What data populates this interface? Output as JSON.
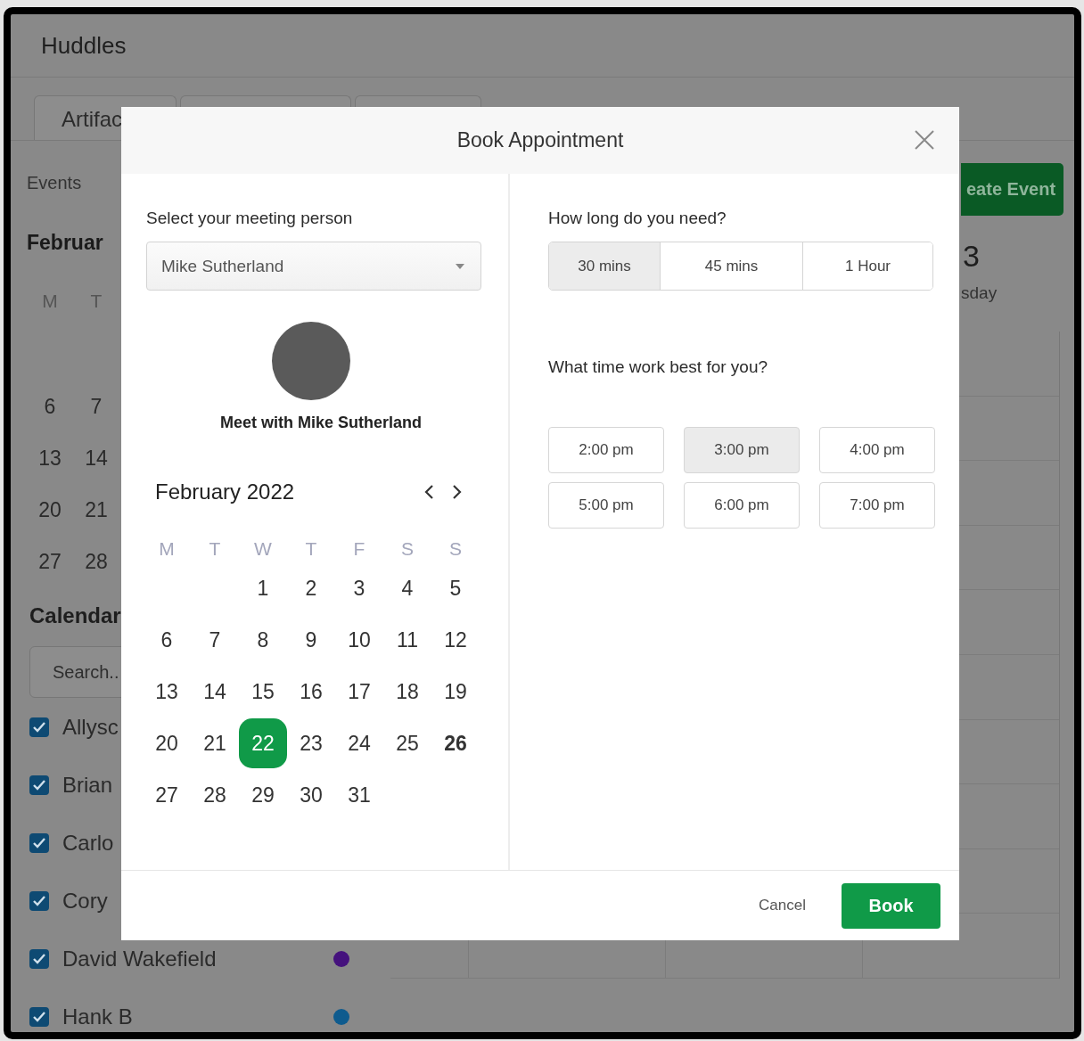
{
  "app": {
    "title": "Huddles",
    "tabs": [
      {
        "kind": "labelled",
        "label": "Artifac"
      },
      {
        "kind": "blank"
      },
      {
        "kind": "blank"
      }
    ],
    "sidebar": {
      "section": "Events",
      "month": "Februar",
      "mini_calendar": {
        "weekdays": [
          "M",
          "T"
        ],
        "rows": [
          [
            "6",
            "7"
          ],
          [
            "13",
            "14"
          ],
          [
            "20",
            "21"
          ],
          [
            "27",
            "28"
          ]
        ]
      },
      "calendars_title": "Calendar",
      "search": {
        "placeholder": "Search.."
      },
      "people": [
        {
          "name": "Allysc",
          "checked": true
        },
        {
          "name": "Brian",
          "checked": true
        },
        {
          "name": "Carlo",
          "checked": true
        },
        {
          "name": "Cory",
          "checked": true
        },
        {
          "name": "David Wakefield",
          "checked": true,
          "color": "#45127d"
        },
        {
          "name": "Hank B",
          "checked": true,
          "color": "#0e5b8e"
        }
      ]
    },
    "main": {
      "create_button": "eate Event",
      "day_number": "3",
      "day_name": "sday"
    }
  },
  "modal": {
    "title": "Book Appointment",
    "person": {
      "label": "Select your meeting person",
      "value": "Mike Sutherland",
      "meet_text": "Meet with Mike Sutherland"
    },
    "calendar": {
      "month": "February 2022",
      "weekdays": [
        "M",
        "T",
        "W",
        "T",
        "F",
        "S",
        "S"
      ],
      "weeks": [
        [
          {
            "d": "1",
            "selected": false,
            "today": false
          },
          {
            "d": "2",
            "selected": false,
            "today": false
          },
          {
            "d": "3",
            "selected": false,
            "today": false
          },
          {
            "d": "4",
            "selected": false,
            "today": false
          },
          {
            "d": "5",
            "selected": false,
            "today": false
          }
        ],
        [
          {
            "d": "6",
            "selected": false,
            "today": false
          },
          {
            "d": "7",
            "selected": false,
            "today": false
          },
          {
            "d": "8",
            "selected": false,
            "today": false
          },
          {
            "d": "9",
            "selected": false,
            "today": false
          },
          {
            "d": "10",
            "selected": false,
            "today": false
          },
          {
            "d": "11",
            "selected": false,
            "today": false
          },
          {
            "d": "12",
            "selected": false,
            "today": false
          }
        ],
        [
          {
            "d": "13",
            "selected": false,
            "today": false
          },
          {
            "d": "14",
            "selected": false,
            "today": false
          },
          {
            "d": "15",
            "selected": false,
            "today": false
          },
          {
            "d": "16",
            "selected": false,
            "today": false
          },
          {
            "d": "17",
            "selected": false,
            "today": false
          },
          {
            "d": "18",
            "selected": false,
            "today": false
          },
          {
            "d": "19",
            "selected": false,
            "today": false
          }
        ],
        [
          {
            "d": "20",
            "selected": false,
            "today": false
          },
          {
            "d": "21",
            "selected": false,
            "today": false
          },
          {
            "d": "22",
            "selected": true,
            "today": false
          },
          {
            "d": "23",
            "selected": false,
            "today": false
          },
          {
            "d": "24",
            "selected": false,
            "today": false
          },
          {
            "d": "25",
            "selected": false,
            "today": false
          },
          {
            "d": "26",
            "selected": false,
            "today": true
          }
        ],
        [
          {
            "d": "27",
            "selected": false,
            "today": false
          },
          {
            "d": "28",
            "selected": false,
            "today": false
          },
          {
            "d": "29",
            "selected": false,
            "today": false
          },
          {
            "d": "30",
            "selected": false,
            "today": false
          },
          {
            "d": "31",
            "selected": false,
            "today": false
          }
        ]
      ]
    },
    "duration": {
      "label": "How long do you need?",
      "options": [
        {
          "label": "30 mins",
          "selected": true
        },
        {
          "label": "45 mins",
          "selected": false
        },
        {
          "label": "1 Hour",
          "selected": false
        }
      ]
    },
    "time": {
      "label": "What time work best for you?",
      "options": [
        {
          "label": "2:00 pm",
          "selected": false
        },
        {
          "label": "3:00 pm",
          "selected": true
        },
        {
          "label": "4:00 pm",
          "selected": false
        },
        {
          "label": "5:00 pm",
          "selected": false
        },
        {
          "label": "6:00 pm",
          "selected": false
        },
        {
          "label": "7:00 pm",
          "selected": false
        }
      ]
    },
    "footer": {
      "cancel": "Cancel",
      "book": "Book"
    }
  }
}
